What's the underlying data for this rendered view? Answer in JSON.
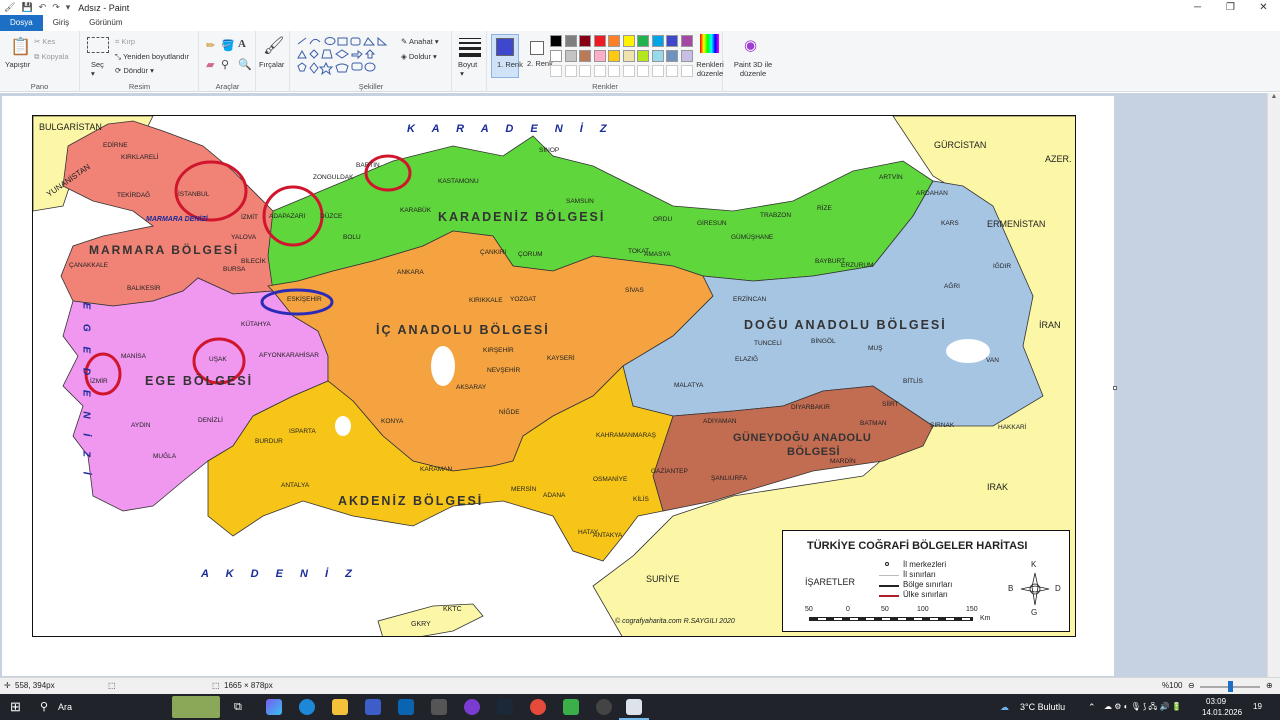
{
  "window": {
    "title": "Adsız - Paint",
    "tabs": [
      "Dosya",
      "Giriş",
      "Görünüm"
    ]
  },
  "ribbon": {
    "clipboard": {
      "paste": "Yapıştır",
      "cut": "Kes",
      "copy": "Kopyala",
      "label": "Pano"
    },
    "image": {
      "select": "Seç",
      "crop": "Kırp",
      "resize": "Yeniden boyutlandır",
      "rotate": "Döndür",
      "label": "Resim"
    },
    "tools": {
      "label": "Araçlar"
    },
    "brushes": {
      "label": "Fırçalar"
    },
    "shapes": {
      "outline": "Anahat",
      "fill": "Doldur",
      "label": "Şekiller"
    },
    "size": {
      "label": "Boyut"
    },
    "colors": {
      "color1": "1. Renk",
      "color2": "2. Renk",
      "edit": "Renkleri düzenle",
      "paint3d": "Paint 3D ile düzenle",
      "label": "Renkler",
      "row1": [
        "#000000",
        "#7f7f7f",
        "#880015",
        "#ed1c24",
        "#ff7f27",
        "#fff200",
        "#22b14c",
        "#00a2e8",
        "#3f48cc",
        "#a349a4"
      ],
      "row2": [
        "#ffffff",
        "#c3c3c3",
        "#b97a57",
        "#ffaec9",
        "#ffc90e",
        "#efe4b0",
        "#b5e61d",
        "#99d9ea",
        "#7092be",
        "#c8bfe7"
      ]
    }
  },
  "map": {
    "seas": {
      "karadeniz": "K A R A D E N İ Z",
      "akdeniz": "A K D E N İ Z",
      "ege": "E G E D E N İ Z İ",
      "marmara": "MARMARA DENİZİ"
    },
    "regions": {
      "karadeniz": "KARADENİZ BÖLGESİ",
      "marmara": "MARMARA BÖLGESİ",
      "ic_anadolu": "İÇ ANADOLU BÖLGESİ",
      "dogu_anadolu": "DOĞU ANADOLU BÖLGESİ",
      "ege": "EGE BÖLGESİ",
      "akdeniz": "AKDENİZ BÖLGESİ",
      "guneydogu_1": "GÜNEYDOĞU ANADOLU",
      "guneydogu_2": "BÖLGESİ"
    },
    "countries": [
      "BULGARİSTAN",
      "YUNANİSTAN",
      "GÜRCİSTAN",
      "AZER.",
      "ERMENİSTAN",
      "İRAN",
      "IRAK",
      "SURİYE",
      "KKTC",
      "GKRY"
    ],
    "cities": [
      "EDİRNE",
      "KIRKLARELİ",
      "TEKİRDAĞ",
      "İSTANBUL",
      "İZMİT",
      "ADAPAZARI",
      "DÜZCE",
      "BOLU",
      "ZONGULDAK",
      "BARTIN",
      "KASTAMONU",
      "SİNOP",
      "KARABÜK",
      "SAMSUN",
      "ORDU",
      "GİRESUN",
      "TRABZON",
      "RİZE",
      "ARTVİN",
      "ARDAHAN",
      "KARS",
      "IĞDIR",
      "AĞRI",
      "ERZURUM",
      "BAYBURT",
      "GÜMÜŞHANE",
      "AMASYA",
      "TOKAT",
      "ÇORUM",
      "ÇANKIRI",
      "ANKARA",
      "KIRIKKALE",
      "YOZGAT",
      "SİVAS",
      "ESKİŞEHİR",
      "KÜTAHYA",
      "BİLECİK",
      "BURSA",
      "YALOVA",
      "BALIKESİR",
      "ÇANAKKALE",
      "MANİSA",
      "İZMİR",
      "UŞAK",
      "AFYONKARAHİSAR",
      "AYDIN",
      "DENİZLİ",
      "MUĞLA",
      "BURDUR",
      "ISPARTA",
      "ANTALYA",
      "KONYA",
      "KARAMAN",
      "AKSARAY",
      "NEVŞEHİR",
      "KIRŞEHİR",
      "KAYSERİ",
      "NİĞDE",
      "MERSİN",
      "ADANA",
      "OSMANİYE",
      "KİLİS",
      "HATAY",
      "ANTAKYA",
      "GAZİANTEP",
      "KAHRAMANMARAŞ",
      "ADIYAMAN",
      "ŞANLIURFA",
      "MARDİN",
      "DİYARBAKIR",
      "BATMAN",
      "SİİRT",
      "ŞIRNAK",
      "HAKKARİ",
      "VAN",
      "BİTLİS",
      "MUŞ",
      "BİNGÖL",
      "TUNCELİ",
      "ELAZIĞ",
      "MALATYA",
      "ERZİNCAN"
    ],
    "credit": "© cografyaharita.com R.SAYGILI 2020"
  },
  "legend": {
    "title": "TÜRKİYE COĞRAFİ BÖLGELER HARİTASI",
    "isaretler": "İŞARETLER",
    "items": [
      "İl merkezleri",
      "İl sınırları",
      "Bölge sınırları",
      "Ülke sınırları"
    ],
    "scale": [
      "50",
      "0",
      "50",
      "100",
      "150"
    ],
    "scale_unit": "Km",
    "compass": {
      "n": "K",
      "s": "G",
      "e": "D",
      "w": "B"
    }
  },
  "status": {
    "cursor": "558, 394px",
    "image_size": "1665 × 878px",
    "zoom": "%100"
  },
  "taskbar": {
    "search": "Ara",
    "weather": "3°C  Bulutlu",
    "time": "03:09",
    "date": "14.01.2026",
    "badge": "19"
  },
  "colors": {
    "marmara": "#f08276",
    "karadeniz": "#5fd63c",
    "ege": "#f097f0",
    "ic_anadolu": "#f4a340",
    "dogu_anadolu": "#a6c5e3",
    "akdeniz": "#f7c518",
    "guneydogu": "#c26c52",
    "foreign": "#fbf7a6",
    "sea": "#ffffff",
    "annotation_red": "#d0162d",
    "annotation_blue": "#2b2bb8"
  }
}
